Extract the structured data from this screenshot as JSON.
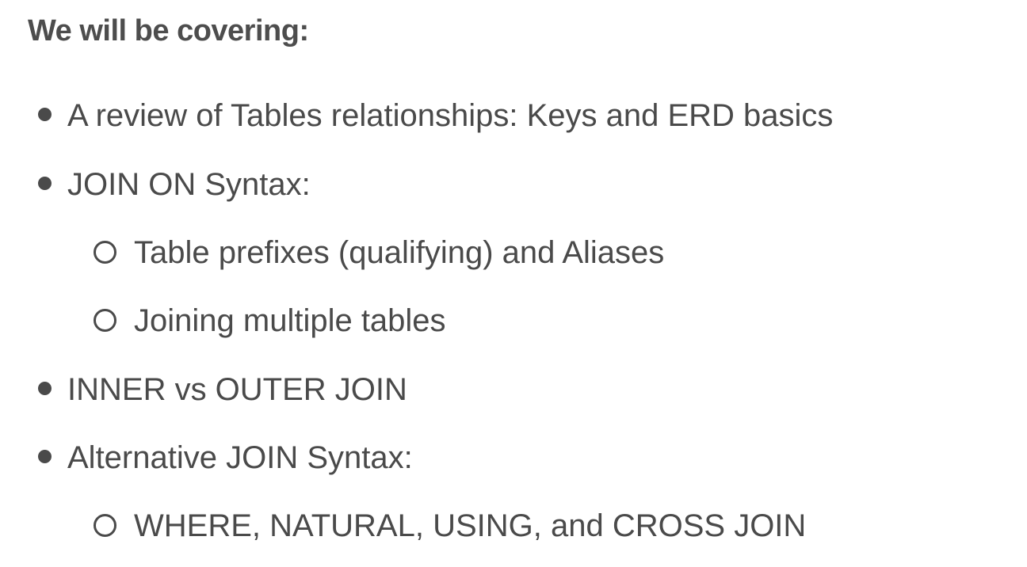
{
  "slide": {
    "heading": "We will be covering:",
    "items": [
      {
        "label": "A review of Tables relationships:  Keys and ERD basics",
        "level": 1,
        "bullet": "filled-dot"
      },
      {
        "label": "JOIN ON Syntax:",
        "level": 1,
        "bullet": "filled-dot"
      },
      {
        "label": "Table prefixes (qualifying) and Aliases",
        "level": 2,
        "bullet": "hollow-circle"
      },
      {
        "label": "Joining multiple tables",
        "level": 2,
        "bullet": "hollow-circle"
      },
      {
        "label": "INNER vs OUTER JOIN",
        "level": 1,
        "bullet": "filled-dot"
      },
      {
        "label": "Alternative JOIN Syntax:",
        "level": 1,
        "bullet": "filled-dot"
      },
      {
        "label": "WHERE, NATURAL, USING, and CROSS JOIN",
        "level": 2,
        "bullet": "hollow-circle"
      }
    ]
  },
  "colors": {
    "text": "#4a4a4a",
    "heading": "#4d4d4d",
    "background": "#ffffff"
  }
}
